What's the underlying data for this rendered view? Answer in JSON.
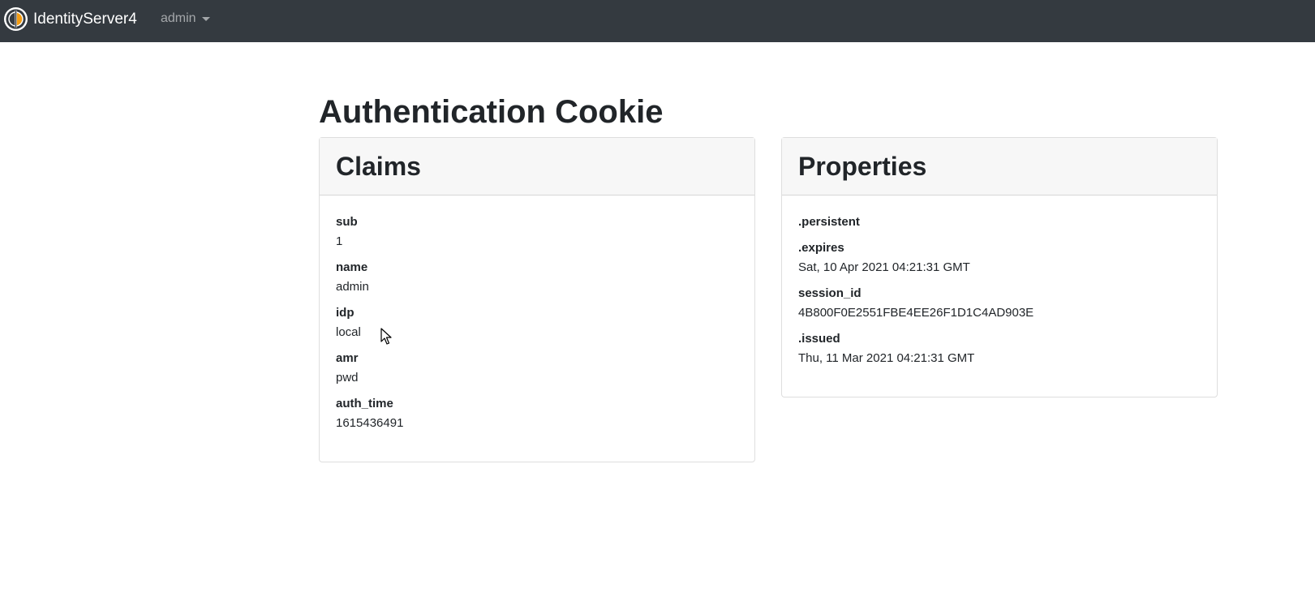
{
  "navbar": {
    "brand_name": "IdentityServer4",
    "user_menu_label": "admin",
    "colors": {
      "background": "#343a40",
      "logo_accent": "#f39c12"
    }
  },
  "page": {
    "title": "Authentication Cookie"
  },
  "claims": {
    "heading": "Claims",
    "items": [
      {
        "key": "sub",
        "value": "1"
      },
      {
        "key": "name",
        "value": "admin"
      },
      {
        "key": "idp",
        "value": "local"
      },
      {
        "key": "amr",
        "value": "pwd"
      },
      {
        "key": "auth_time",
        "value": "1615436491"
      }
    ]
  },
  "properties": {
    "heading": "Properties",
    "items": [
      {
        "key": ".persistent",
        "value": ""
      },
      {
        "key": ".expires",
        "value": "Sat, 10 Apr 2021 04:21:31 GMT"
      },
      {
        "key": "session_id",
        "value": "4B800F0E2551FBE4EE26F1D1C4AD903E"
      },
      {
        "key": ".issued",
        "value": "Thu, 11 Mar 2021 04:21:31 GMT"
      }
    ]
  }
}
